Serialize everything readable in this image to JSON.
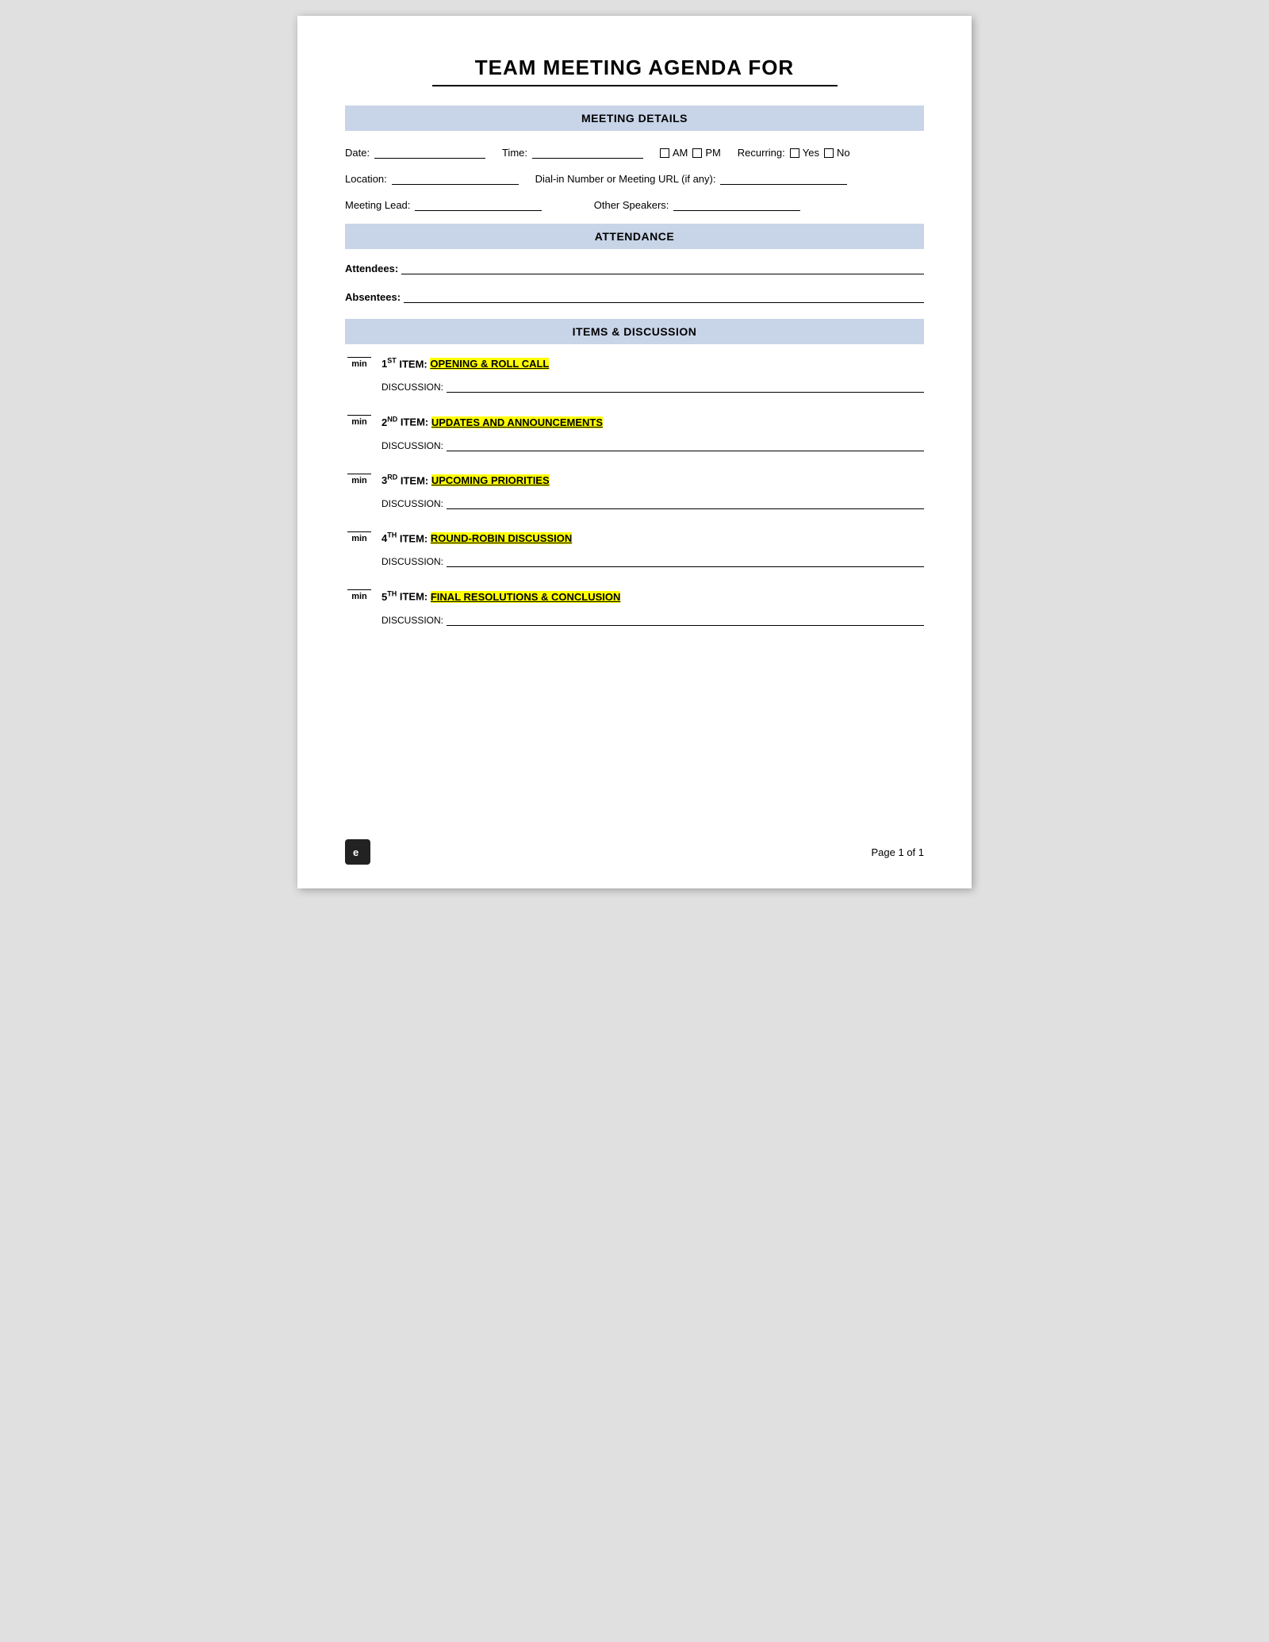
{
  "title": {
    "main": "TEAM MEETING AGENDA FOR",
    "underline": true
  },
  "sections": {
    "meeting_details": {
      "header": "MEETING DETAILS",
      "fields": {
        "date_label": "Date:",
        "time_label": "Time:",
        "am_label": "AM",
        "pm_label": "PM",
        "recurring_label": "Recurring:",
        "yes_label": "Yes",
        "no_label": "No",
        "location_label": "Location:",
        "dialin_label": "Dial-in Number or Meeting URL (if any):",
        "meeting_lead_label": "Meeting Lead:",
        "other_speakers_label": "Other Speakers:"
      }
    },
    "attendance": {
      "header": "ATTENDANCE",
      "attendees_label": "Attendees:",
      "absentees_label": "Absentees:"
    },
    "items_discussion": {
      "header": "ITEMS & DISCUSSION",
      "items": [
        {
          "number": "1",
          "ordinal": "ST",
          "title_prefix": "ITEM:",
          "title_highlight": "OPENING & ROLL CALL",
          "discussion_label": "DISCUSSION:"
        },
        {
          "number": "2",
          "ordinal": "ND",
          "title_prefix": "ITEM:",
          "title_highlight": "UPDATES AND ANNOUNCEMENTS",
          "discussion_label": "DISCUSSION:"
        },
        {
          "number": "3",
          "ordinal": "RD",
          "title_prefix": "ITEM:",
          "title_highlight": "UPCOMING PRIORITIES",
          "discussion_label": "DISCUSSION:"
        },
        {
          "number": "4",
          "ordinal": "TH",
          "title_prefix": "ITEM:",
          "title_highlight": "ROUND-ROBIN DISCUSSION",
          "discussion_label": "DISCUSSION:"
        },
        {
          "number": "5",
          "ordinal": "TH",
          "title_prefix": "ITEM:",
          "title_highlight": "FINAL RESOLUTIONS & CONCLUSION",
          "discussion_label": "DISCUSSION:"
        }
      ]
    }
  },
  "footer": {
    "page_label": "Page 1 of 1",
    "icon": "e"
  },
  "colors": {
    "section_header_bg": "#c8d4e8",
    "highlight_yellow": "#ffff00",
    "icon_bg": "#222222"
  }
}
